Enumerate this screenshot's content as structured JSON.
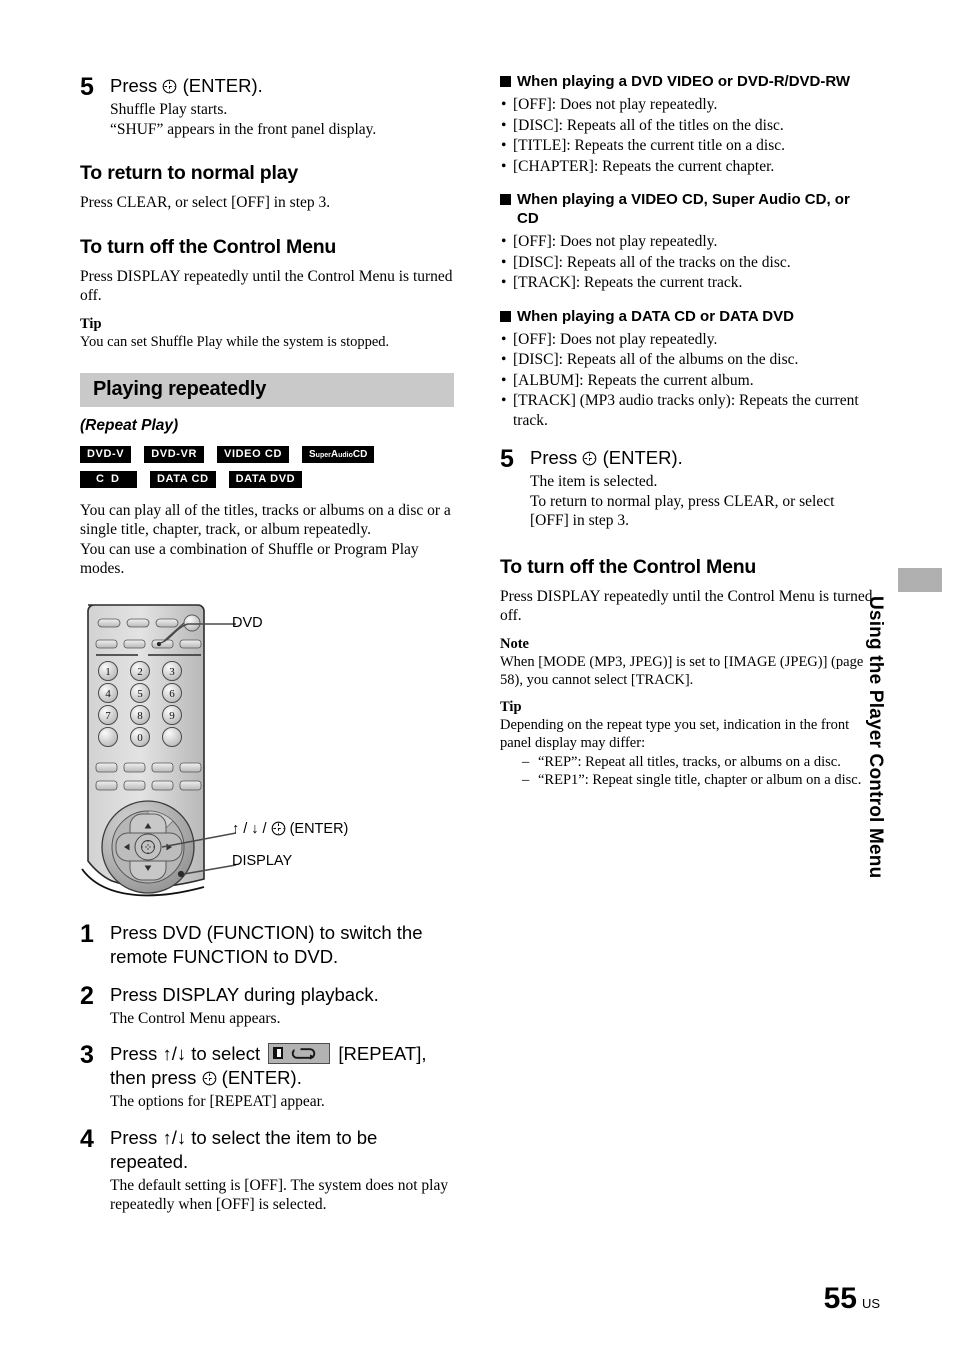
{
  "page": {
    "number": "55",
    "region": "US"
  },
  "side_tab": {
    "title": "Using the Player Control Menu"
  },
  "left": {
    "step5": {
      "num": "5",
      "head_before": "Press",
      "head_after": "(ENTER).",
      "sub_line1": "Shuffle Play starts.",
      "sub_line2": "“SHUF” appears in the front panel display."
    },
    "heading_return": "To return to normal play",
    "return_body": "Press CLEAR, or select [OFF] in step 3.",
    "heading_turnoff": "To turn off the Control Menu",
    "turnoff_body": "Press DISPLAY repeatedly until the Control Menu is turned off.",
    "tip_label": "Tip",
    "tip_body": "You can set Shuffle Play while the system is stopped.",
    "section_title": "Playing repeatedly",
    "section_subtitle": "(Repeat Play)",
    "badges": [
      "DVD-V",
      "DVD-VR",
      "VIDEO CD",
      "Super Audio CD",
      "C D",
      "DATA CD",
      "DATA DVD"
    ],
    "intro_p1": "You can play all of the titles, tracks or albums on a disc or a single title, chapter, track, or album repeatedly.",
    "intro_p2": "You can use a combination of Shuffle or Program Play modes.",
    "remote": {
      "callout_dvd": "DVD",
      "callout_enter": "(ENTER)",
      "callout_enter_arrows": "/ /",
      "callout_display": "DISPLAY",
      "keys": [
        "1",
        "2",
        "3",
        "4",
        "5",
        "6",
        "7",
        "8",
        "9",
        "0"
      ]
    },
    "step1": {
      "num": "1",
      "head": "Press DVD (FUNCTION) to switch the remote FUNCTION to DVD."
    },
    "step2": {
      "num": "2",
      "head": "Press DISPLAY during playback.",
      "sub": "The Control Menu appears."
    },
    "step3": {
      "num": "3",
      "head_a": "Press",
      "head_b": "to select",
      "head_c": "[REPEAT],",
      "head_d": "then press",
      "head_e": "(ENTER).",
      "sub": "The options for [REPEAT] appear."
    },
    "step4": {
      "num": "4",
      "head_a": "Press",
      "head_b": "to select the item to be repeated.",
      "sub": "The default setting is [OFF]. The system does not play repeatedly when [OFF] is selected."
    }
  },
  "right": {
    "group1": {
      "head": "When playing a DVD VIDEO or DVD-R/DVD-RW",
      "items": [
        "[OFF]: Does not play repeatedly.",
        "[DISC]: Repeats all of the titles on the disc.",
        "[TITLE]: Repeats the current title on a disc.",
        "[CHAPTER]: Repeats the current chapter."
      ]
    },
    "group2": {
      "head": "When playing a VIDEO CD, Super Audio CD, or CD",
      "items": [
        "[OFF]: Does not play repeatedly.",
        "[DISC]: Repeats all of the tracks on the disc.",
        "[TRACK]: Repeats the current track."
      ]
    },
    "group3": {
      "head": "When playing a DATA CD or DATA DVD",
      "items": [
        "[OFF]: Does not play repeatedly.",
        "[DISC]: Repeats all of the albums on the disc.",
        "[ALBUM]: Repeats the current album.",
        "[TRACK] (MP3 audio tracks only): Repeats the current track."
      ]
    },
    "step5": {
      "num": "5",
      "head_before": "Press",
      "head_after": "(ENTER).",
      "sub_line1": "The item is selected.",
      "sub_line2": "To return to normal play, press CLEAR, or select [OFF] in step 3."
    },
    "heading_turnoff": "To turn off the Control Menu",
    "turnoff_body": "Press DISPLAY repeatedly until the Control Menu is turned off.",
    "note_label": "Note",
    "note_body": "When [MODE (MP3, JPEG)] is set to [IMAGE (JPEG)] (page 58), you cannot select [TRACK].",
    "tip_label": "Tip",
    "tip_body": "Depending on the repeat type you set, indication in the front panel display may differ:",
    "tip_items": [
      "“REP”: Repeat all titles, tracks, or albums on a disc.",
      "“REP1”: Repeat single title, chapter or album on a disc."
    ]
  }
}
